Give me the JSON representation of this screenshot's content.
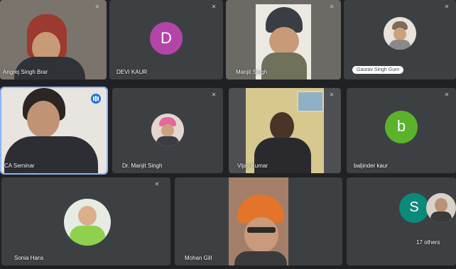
{
  "participants": [
    {
      "name": "Angrej Singh Brar"
    },
    {
      "name": "DEVI KAUR",
      "initial": "D",
      "color": "#b445a8"
    },
    {
      "name": "Manjit Singh"
    },
    {
      "pill": "Gaurav Singh Gurn"
    },
    {
      "name": "CA Seminar"
    },
    {
      "name": "Dr. Manjit Singh"
    },
    {
      "name": "Vijay Kumar"
    },
    {
      "name": "baljinder kaur",
      "initial": "b",
      "color": "#5bb22d"
    },
    {
      "name": "Sonia Hans"
    },
    {
      "name": "Mohan Gill"
    },
    {
      "others_initial": "S",
      "others_color": "#0b8a7a",
      "others_label": "17 others"
    }
  ],
  "icons": {
    "mic_off": "mic-off-icon",
    "speaking": "speaking-indicator-icon"
  }
}
